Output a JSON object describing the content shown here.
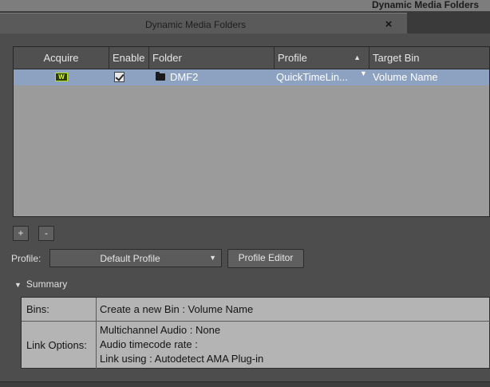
{
  "window": {
    "title": "Dynamic Media Folders"
  },
  "tab": {
    "title": "Dynamic Media Folders",
    "close_icon": "×"
  },
  "table": {
    "columns": [
      {
        "label": "Acquire"
      },
      {
        "label": "Enable"
      },
      {
        "label": "Folder"
      },
      {
        "label": "Profile"
      },
      {
        "label": "Target Bin"
      }
    ],
    "sort_icon": "▲",
    "rows": [
      {
        "acquire_icon_text": "W",
        "enabled": true,
        "folder": "DMF2",
        "profile": "QuickTimeLin...",
        "target_bin": "Volume Name"
      }
    ],
    "row_color": "#8da2c1"
  },
  "buttons": {
    "add": "+",
    "remove": "-",
    "profile_editor": "Profile Editor"
  },
  "profile": {
    "label": "Profile:",
    "value": "Default Profile"
  },
  "summary": {
    "toggle_label": "Summary",
    "bins_label": "Bins:",
    "bins_value": "Create a new Bin : Volume Name",
    "link_label": "Link Options:",
    "link_lines": [
      "Multichannel Audio : None",
      "Audio timecode rate :",
      "Link using : Autodetect AMA Plug-in"
    ]
  }
}
